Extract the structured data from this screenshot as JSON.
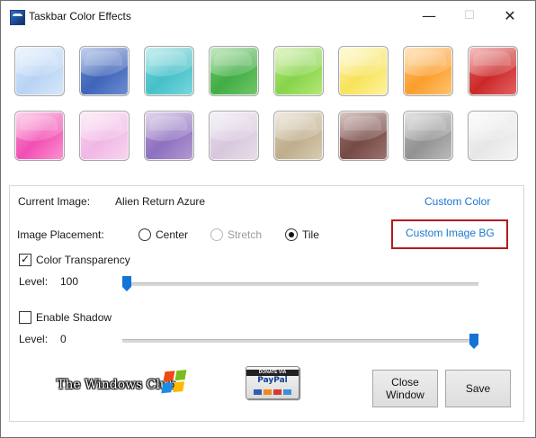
{
  "window": {
    "title": "Taskbar Color Effects",
    "controls": {
      "minimize_symbol": "—",
      "maximize_symbol": "☐",
      "close_symbol": "✕"
    }
  },
  "swatches": [
    {
      "name": "light-blue",
      "color": "#d7e9fb",
      "accent": "#b8d3f4"
    },
    {
      "name": "blue",
      "color": "#6e8fd2",
      "accent": "#3f64b9"
    },
    {
      "name": "aqua",
      "color": "#78d8dd",
      "accent": "#46c0c8"
    },
    {
      "name": "green",
      "color": "#73c86a",
      "accent": "#41ad44"
    },
    {
      "name": "lime",
      "color": "#b7e879",
      "accent": "#86d44a"
    },
    {
      "name": "yellow",
      "color": "#fff3a2",
      "accent": "#f7e35b"
    },
    {
      "name": "orange",
      "color": "#ffc46d",
      "accent": "#fb9d2d"
    },
    {
      "name": "red",
      "color": "#e46565",
      "accent": "#cb2828"
    },
    {
      "name": "pink",
      "color": "#ff92d1",
      "accent": "#f04fb4"
    },
    {
      "name": "light-pink",
      "color": "#f9d5f1",
      "accent": "#f0b7e5"
    },
    {
      "name": "purple",
      "color": "#b59bd4",
      "accent": "#8d70c0"
    },
    {
      "name": "lavender",
      "color": "#e9deeb",
      "accent": "#d7c8dd"
    },
    {
      "name": "tan",
      "color": "#d9cdb4",
      "accent": "#bfad8a"
    },
    {
      "name": "brown",
      "color": "#9e7470",
      "accent": "#754a45"
    },
    {
      "name": "gray",
      "color": "#bcbcbc",
      "accent": "#929292"
    },
    {
      "name": "white",
      "color": "#f6f6f6",
      "accent": "#e6e6e6"
    }
  ],
  "settings": {
    "current_image_label": "Current Image:",
    "current_image_value": "Alien Return Azure",
    "custom_color_label": "Custom Color",
    "image_placement_label": "Image Placement:",
    "placement_options": [
      {
        "label": "Center",
        "selected": false,
        "disabled": false
      },
      {
        "label": "Stretch",
        "selected": false,
        "disabled": true
      },
      {
        "label": "Tile",
        "selected": true,
        "disabled": false
      }
    ],
    "custom_image_bg_label": "Custom Image BG",
    "color_transparency_label": "Color Transparency",
    "color_transparency_checked": true,
    "transparency_level_label": "Level:",
    "transparency_level_value": "100",
    "transparency_level_fraction": 0.0,
    "enable_shadow_label": "Enable Shadow",
    "enable_shadow_checked": false,
    "shadow_level_label": "Level:",
    "shadow_level_value": "0",
    "shadow_level_fraction": 1.0
  },
  "footer": {
    "twc_logo_text": "The Windows Club",
    "paypal_donate_text": "DONATE VIA",
    "paypal_brand": "PayPal",
    "close_button_label": "Close Window",
    "save_button_label": "Save",
    "accent_color": "#1373d8",
    "link_color": "#1a78cf",
    "highlight_color": "#b01d1d"
  }
}
